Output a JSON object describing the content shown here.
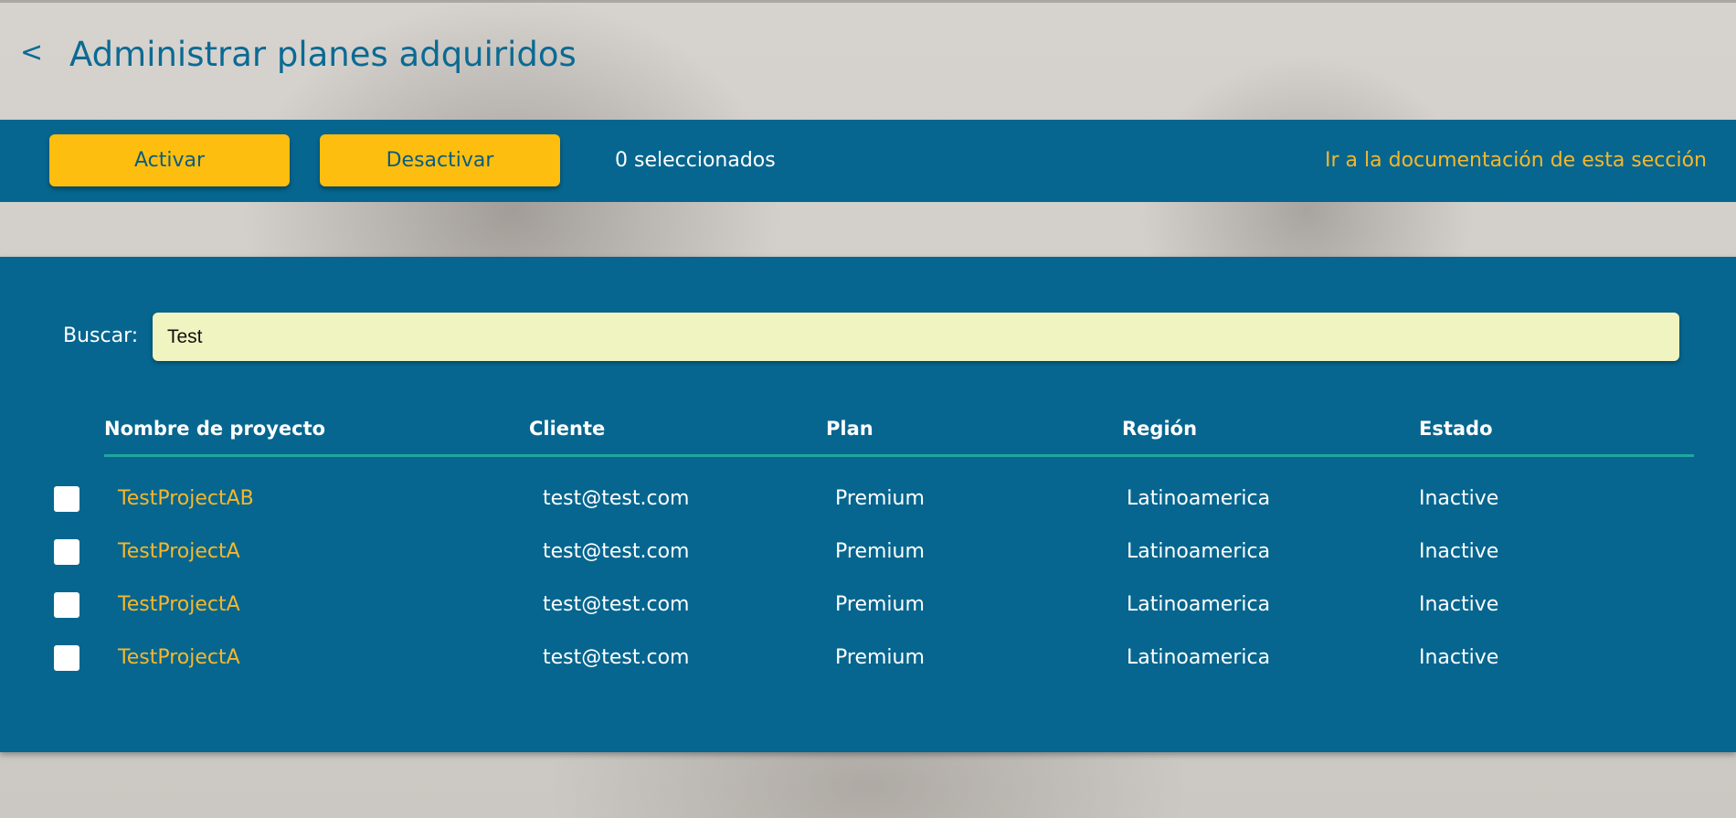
{
  "header": {
    "back_label": "<",
    "title": "Administrar planes adquiridos"
  },
  "toolbar": {
    "activate_label": "Activar",
    "deactivate_label": "Desactivar",
    "selected_count": "0 seleccionados",
    "doc_link": "Ir a la documentación de esta sección"
  },
  "search": {
    "label": "Buscar:",
    "value": "Test",
    "placeholder": ""
  },
  "table": {
    "columns": [
      "Nombre de proyecto",
      "Cliente",
      "Plan",
      "Región",
      "Estado"
    ],
    "rows": [
      {
        "project": "TestProjectAB",
        "client": "test@test.com",
        "plan": "Premium",
        "region": "Latinoamerica",
        "status": "Inactive",
        "checked": false
      },
      {
        "project": "TestProjectA",
        "client": "test@test.com",
        "plan": "Premium",
        "region": "Latinoamerica",
        "status": "Inactive",
        "checked": false
      },
      {
        "project": "TestProjectA",
        "client": "test@test.com",
        "plan": "Premium",
        "region": "Latinoamerica",
        "status": "Inactive",
        "checked": false
      },
      {
        "project": "TestProjectA",
        "client": "test@test.com",
        "plan": "Premium",
        "region": "Latinoamerica",
        "status": "Inactive",
        "checked": false
      }
    ]
  },
  "colors": {
    "primary": "#06668f",
    "title": "#0b6a93",
    "accent_button": "#fdbe0f",
    "link": "#f6b72c",
    "search_bg": "#f0f4c0",
    "header_rule": "#1fa7a0"
  }
}
